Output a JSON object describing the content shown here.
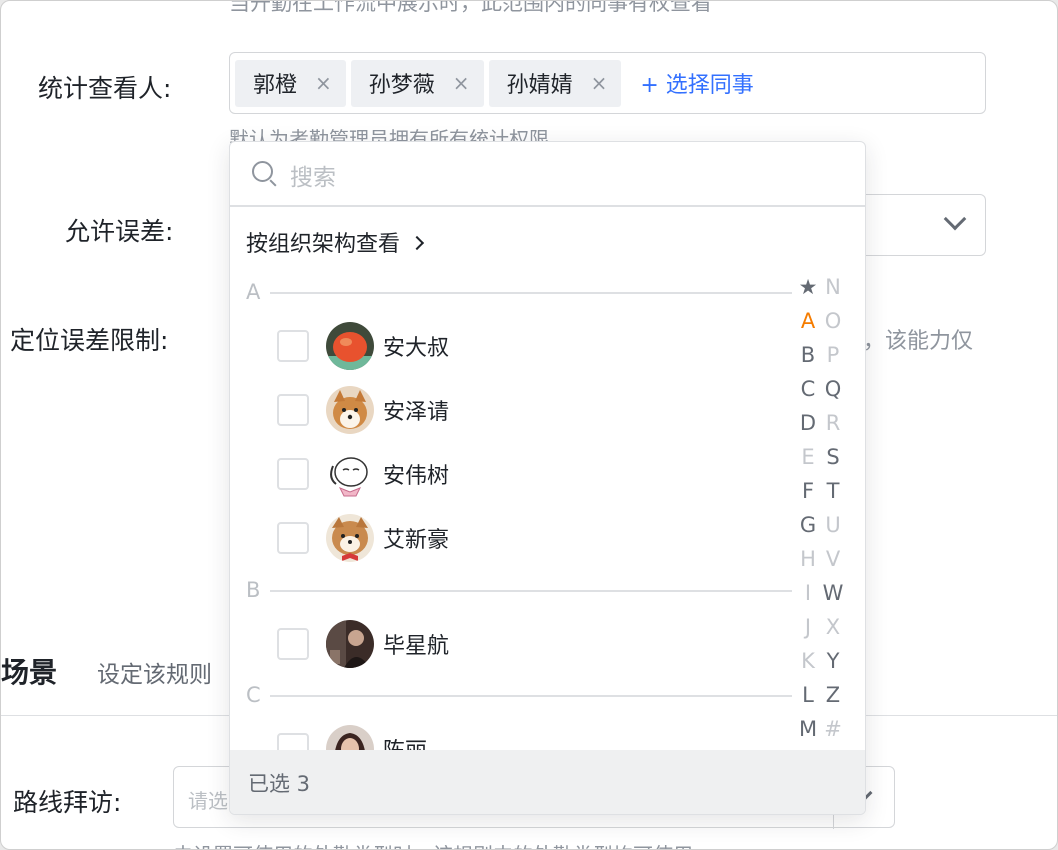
{
  "form": {
    "top_hint_cut": "当开勤在工作流中展示时，此范围内的同事有权查看",
    "stat_viewer_label": "统计查看人:",
    "tags": [
      {
        "label": "郭橙",
        "remove": "×"
      },
      {
        "label": "孙梦薇",
        "remove": "×"
      },
      {
        "label": "孙婧婧",
        "remove": "×"
      }
    ],
    "choose_colleague": "+ 选择同事",
    "default_hint": "默认为考勤管理员拥有所有统计权限",
    "tolerance_label": "允许误差:",
    "location_limit_label": "定位误差限制:",
    "location_trailing": "，该能力仅",
    "section_title": "场景",
    "section_desc": "设定该规则",
    "route_label": "路线拜访:",
    "route_placeholder": "请选",
    "bottom_hint": "未设置可使用的外勤类型时，该规则中的外勤类型均可使用"
  },
  "picker": {
    "search_placeholder": "搜索",
    "org_view": "按组织架构查看",
    "groups": [
      {
        "letter": "A",
        "people": [
          {
            "name": "安大叔",
            "avatar": "orange-avatar",
            "checked": false
          },
          {
            "name": "安泽请",
            "avatar": "shiba-avatar",
            "checked": false
          },
          {
            "name": "安伟树",
            "avatar": "cartoon-dog-avatar",
            "checked": false
          },
          {
            "name": "艾新豪",
            "avatar": "shiba-bowtie-avatar",
            "checked": false
          }
        ]
      },
      {
        "letter": "B",
        "people": [
          {
            "name": "毕星航",
            "avatar": "photo-avatar",
            "checked": false
          }
        ]
      },
      {
        "letter": "C",
        "people": [
          {
            "name": "陈丽",
            "avatar": "portrait-avatar",
            "checked": false
          }
        ]
      }
    ],
    "index_left": [
      "★",
      "A",
      "B",
      "C",
      "D",
      "E",
      "F",
      "G",
      "H",
      "I",
      "J",
      "K",
      "L",
      "M"
    ],
    "index_right": [
      "N",
      "O",
      "P",
      "Q",
      "R",
      "S",
      "T",
      "U",
      "V",
      "W",
      "X",
      "Y",
      "Z",
      "#"
    ],
    "index_active": "A",
    "selected_text": "已选 3"
  },
  "colors": {
    "accent": "#3370ff",
    "index_active": "#f57c00",
    "text": "#1f2329",
    "muted": "#8f959e"
  }
}
